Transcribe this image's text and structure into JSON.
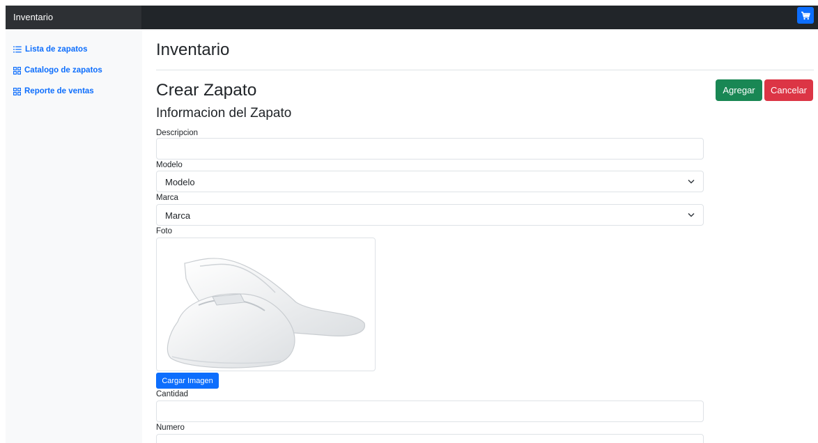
{
  "topbar": {
    "brand": "Inventario",
    "cart_icon": "cart-icon",
    "cart_color": "#0d6efd"
  },
  "sidebar": {
    "items": [
      {
        "label": "Lista de zapatos",
        "icon": "list-icon"
      },
      {
        "label": "Catalogo de zapatos",
        "icon": "grid-icon"
      },
      {
        "label": "Reporte de ventas",
        "icon": "grid-icon"
      }
    ]
  },
  "main": {
    "page_title": "Inventario",
    "section_title": "Crear Zapato",
    "sub_title": "Informacion del Zapato",
    "actions": {
      "add_label": "Agregar",
      "cancel_label": "Cancelar",
      "add_color": "#198754",
      "cancel_color": "#dc3545"
    },
    "form": {
      "descripcion": {
        "label": "Descripcion",
        "value": ""
      },
      "modelo": {
        "label": "Modelo",
        "selected": "Modelo"
      },
      "marca": {
        "label": "Marca",
        "selected": "Marca"
      },
      "foto": {
        "label": "Foto",
        "upload_label": "Cargar Imagen"
      },
      "cantidad": {
        "label": "Cantidad",
        "value": ""
      },
      "numero": {
        "label": "Numero",
        "value": ""
      }
    }
  }
}
